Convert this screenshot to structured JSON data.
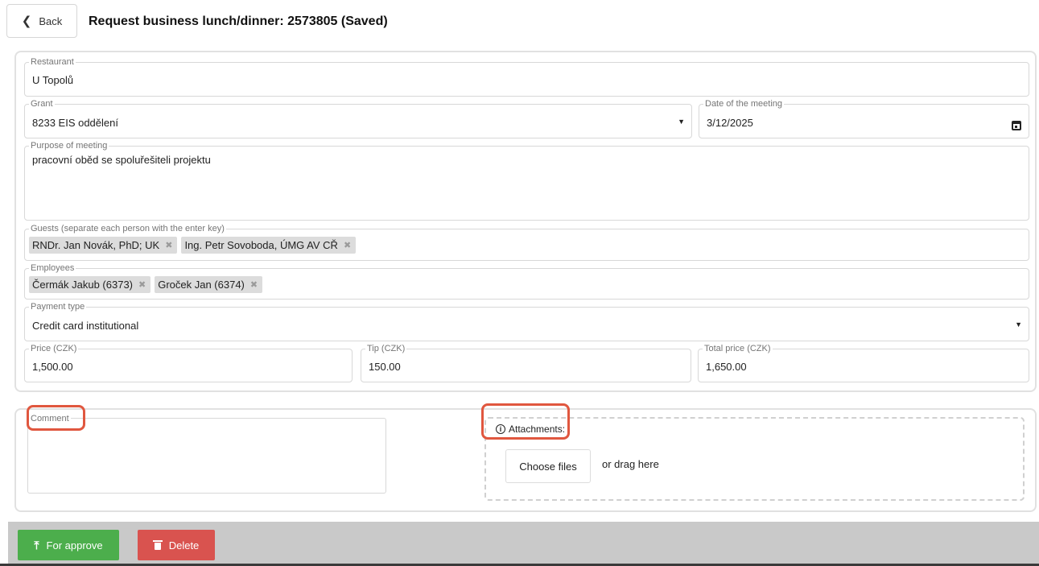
{
  "header": {
    "back_label": "Back",
    "title": "Request business lunch/dinner: 2573805 (Saved)"
  },
  "form": {
    "restaurant": {
      "label": "Restaurant",
      "value": "U Topolů"
    },
    "grant": {
      "label": "Grant",
      "value": "8233 EIS oddělení"
    },
    "date": {
      "label": "Date of the meeting",
      "value": "3/12/2025"
    },
    "purpose": {
      "label": "Purpose of meeting",
      "value": "pracovní oběd se spolu­řešiteli projektu"
    },
    "guests": {
      "label": "Guests (separate each person with the enter key)",
      "chips": [
        "RNDr. Jan Novák, PhD; UK",
        "Ing. Petr Sovoboda, ÚMG AV CŘ"
      ]
    },
    "employees": {
      "label": "Employees",
      "chips": [
        "Čermák Jakub (6373)",
        "Groček Jan (6374)"
      ]
    },
    "payment_type": {
      "label": "Payment type",
      "value": "Credit card institutional"
    },
    "price": {
      "label": "Price (CZK)",
      "value": "1,500.00"
    },
    "tip": {
      "label": "Tip (CZK)",
      "value": "150.00"
    },
    "total": {
      "label": "Total price (CZK)",
      "value": "1,650.00"
    }
  },
  "comment": {
    "label": "Comment",
    "value": ""
  },
  "attachments": {
    "label": "Attachments:",
    "choose_label": "Choose files",
    "drag_label": "or drag here"
  },
  "footer": {
    "approve_label": "For approve",
    "delete_label": "Delete"
  },
  "icons": {
    "back": "chevron-left-icon",
    "dropdown": "caret-down-icon",
    "calendar": "calendar-icon",
    "remove_chip": "close-icon",
    "info": "info-icon",
    "approve": "upload-icon",
    "delete": "trash-icon"
  },
  "colors": {
    "approve": "#4cae4c",
    "delete": "#d9534f",
    "highlight": "#e0573f",
    "footer_bg": "#c9c9c9"
  }
}
